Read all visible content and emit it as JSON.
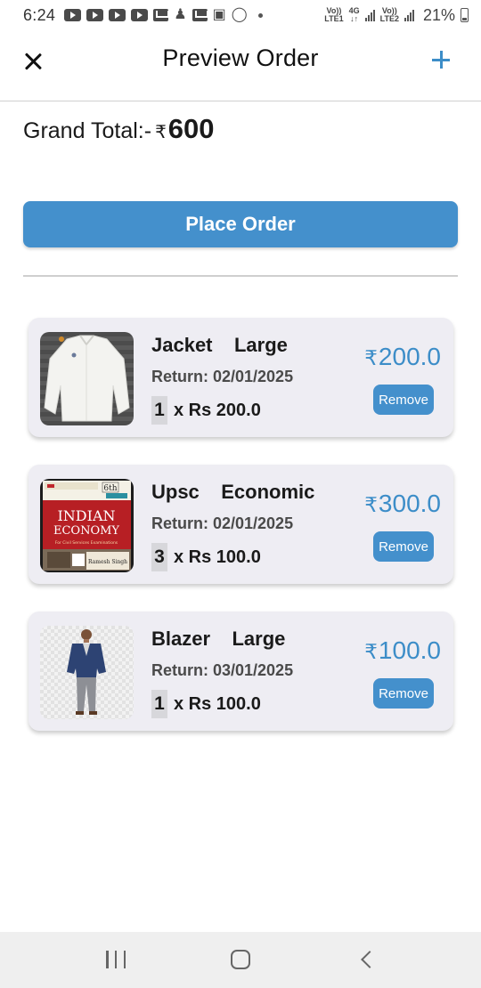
{
  "status_bar": {
    "time": "6:24",
    "network1": [
      "Vo))",
      "LTE1"
    ],
    "network1_type": "4G",
    "network2": [
      "Vo))",
      "LTE2"
    ],
    "battery": "21%"
  },
  "header": {
    "title": "Preview Order",
    "close_icon": "close-icon",
    "add_icon": "plus-icon",
    "accent_color": "#3c8dc8"
  },
  "summary": {
    "label": "Grand Total:-",
    "currency": "₹",
    "amount": "600"
  },
  "place_order": {
    "label": "Place Order",
    "color": "#4490cc"
  },
  "items": [
    {
      "name": "Jacket    Large",
      "return": "Return: 02/01/2025",
      "qty": "1",
      "unit": "x Rs 200.0",
      "currency": "₹",
      "price": "200.0",
      "remove_label": "Remove",
      "image": "white-jacket-image"
    },
    {
      "name": "Upsc    Economic",
      "return": "Return: 02/01/2025",
      "qty": "3",
      "unit": "x Rs 100.0",
      "currency": "₹",
      "price": "300.0",
      "remove_label": "Remove",
      "image": "book-cover-image",
      "book_title_line1": "INDIAN",
      "book_title_line2": "ECONOMY",
      "book_edition": "6th",
      "book_subtitle": "For Civil Services Examinations",
      "book_author": "Ramesh Singh"
    },
    {
      "name": "Blazer    Large",
      "return": "Return: 03/01/2025",
      "qty": "1",
      "unit": "x Rs 100.0",
      "currency": "₹",
      "price": "100.0",
      "remove_label": "Remove",
      "image": "blazer-model-image"
    }
  ],
  "nav_bar": {
    "recent_icon": "recent-apps-icon",
    "home_icon": "home-icon",
    "back_icon": "back-icon"
  }
}
